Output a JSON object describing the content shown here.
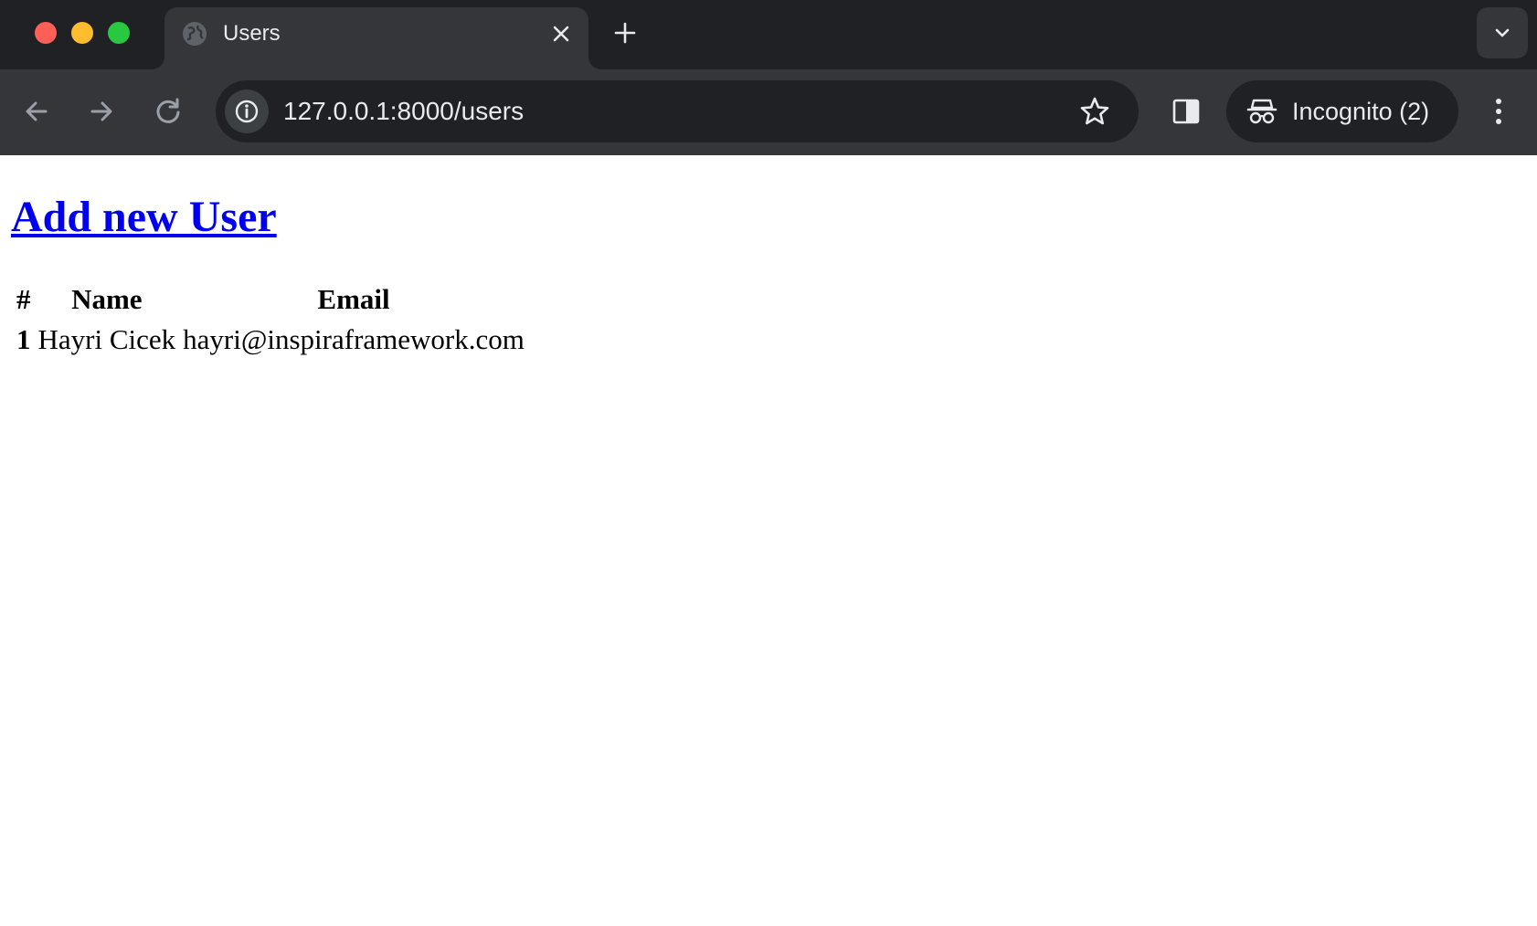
{
  "browser": {
    "tab": {
      "title": "Users"
    },
    "omnibox": {
      "url": "127.0.0.1:8000/users"
    },
    "profile": {
      "label": "Incognito (2)"
    },
    "colors": {
      "tabstrip": "#202124",
      "toolbar": "#35363a",
      "text": "#e8eaed"
    }
  },
  "page": {
    "add_link": "Add new User",
    "table": {
      "headers": [
        "#",
        "Name",
        "Email"
      ],
      "rows": [
        {
          "id": "1",
          "name": "Hayri Cicek",
          "email": "hayri@inspiraframework.com"
        }
      ]
    },
    "link_color": "#0000ee"
  }
}
